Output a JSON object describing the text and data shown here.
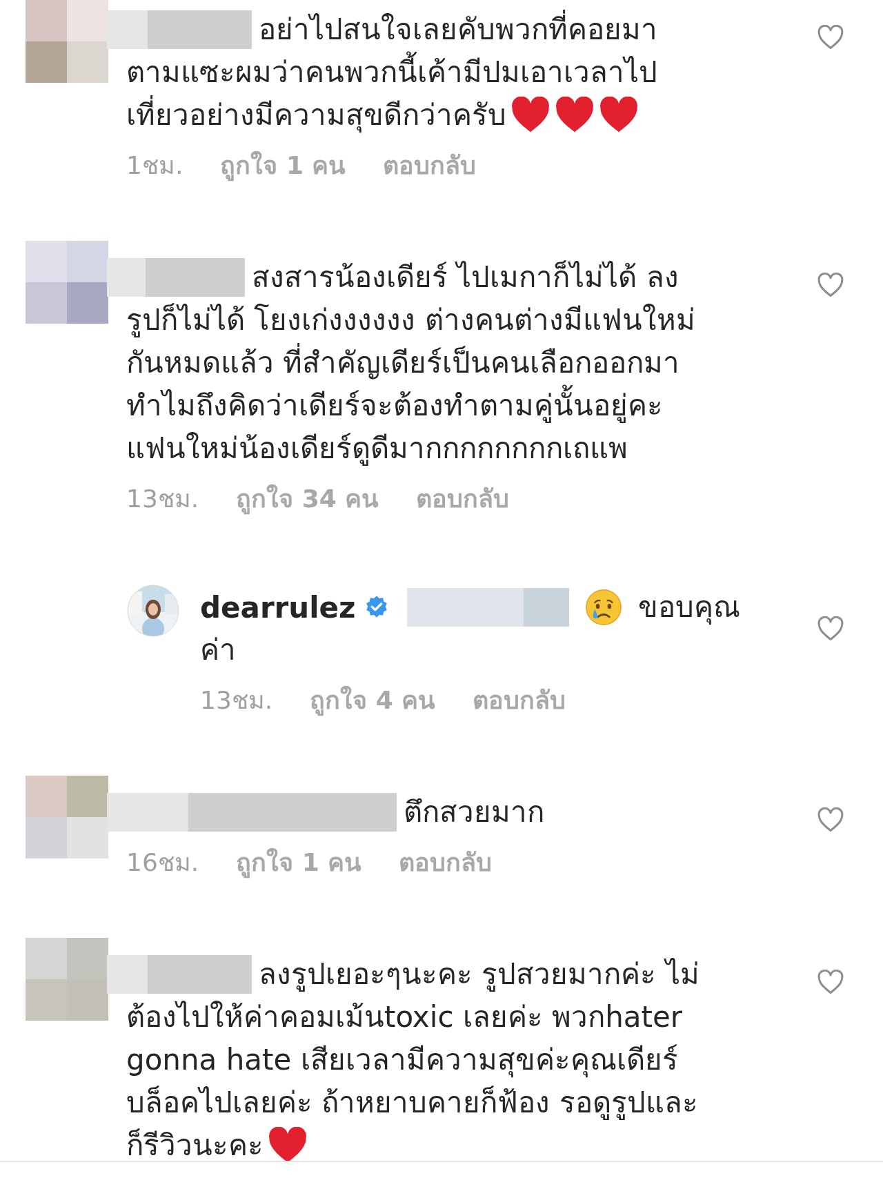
{
  "comments": [
    {
      "first_line": "อย่าไปสนใจเลยคับพวกที่คอยมา",
      "lines": [
        "ตามแซะผมว่าคนพวกนี้เค้ามีปมเอาเวลาไป",
        "เที่ยวอย่างมีความสุขดีกว่าครับ"
      ],
      "emojis_after": [
        {
          "kind": "heart"
        },
        {
          "kind": "heart"
        },
        {
          "kind": "heart"
        }
      ],
      "time": "1ชม.",
      "likes": "ถูกใจ 1 คน",
      "reply": "ตอบกลับ"
    },
    {
      "first_line": "สงสารน้องเดียร์ ไปเมกาก็ไม่ได้ ลง",
      "lines": [
        "รูปก็ไม่ได้ โยงเก่งงงงงง ต่างคนต่างมีแฟนใหม่",
        "กันหมดแล้ว ที่สำคัญเดียร์เป็นคนเลือกออกมา",
        "ทำไมถึงคิดว่าเดียร์จะต้องทำตามคู่นั้นอยู่คะ",
        "แฟนใหม่น้องเดียร์ดูดีมากกกกกกกกเถแพ"
      ],
      "time": "13ชม.",
      "likes": "ถูกใจ 34 คน",
      "reply": "ตอบกลับ",
      "replies": [
        {
          "username": "dearrulez",
          "verified": true,
          "emojis_before": [
            {
              "kind": "crying"
            }
          ],
          "first_line": "ขอบคุณ",
          "lines": [
            "ค่า"
          ],
          "time": "13ชม.",
          "likes": "ถูกใจ 4 คน",
          "reply": "ตอบกลับ"
        }
      ]
    },
    {
      "first_line": "ตึกสวยมาก",
      "time": "16ชม.",
      "likes": "ถูกใจ 1 คน",
      "reply": "ตอบกลับ"
    },
    {
      "first_line": "ลงรูปเยอะๆนะคะ รูปสวยมากค่ะ ไม่",
      "lines": [
        "ต้องไปให้ค่าคอมเม้นtoxic เลยค่ะ พวกhater",
        "gonna hate เสียเวลามีความสุขค่ะคุณเดียร์",
        "บล็อคไปเลยค่ะ ถ้าหยาบคายก็ฟ้อง รอดูรูปและ",
        "ก็รีวิวนะคะ"
      ],
      "emojis_after": [
        {
          "kind": "heart"
        }
      ]
    }
  ]
}
